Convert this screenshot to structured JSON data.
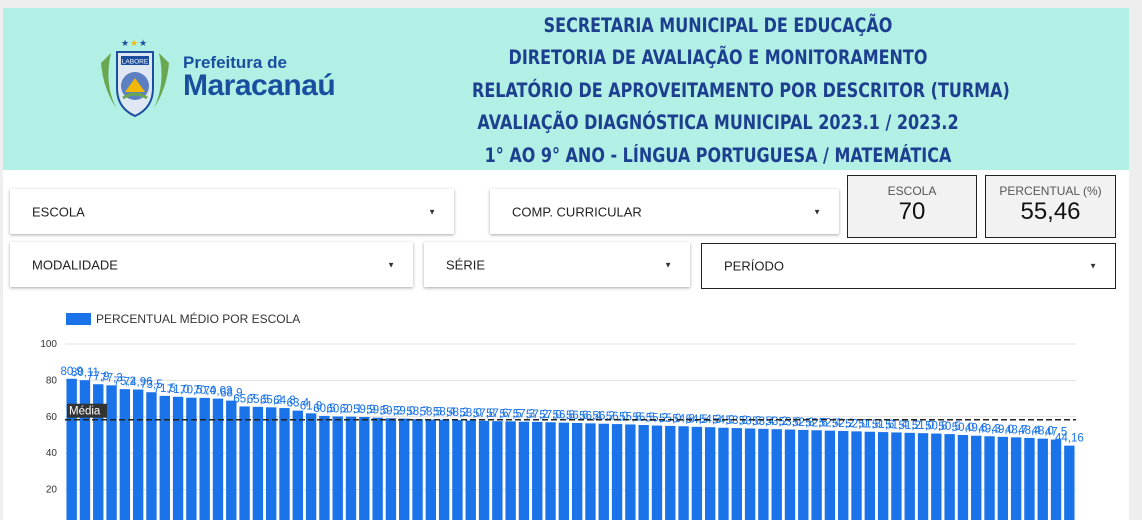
{
  "header": {
    "logo": {
      "line1": "Prefeitura de",
      "line2": "Maracanaú",
      "seal_text": "LABORE"
    },
    "title_lines": [
      "SECRETARIA MUNICIPAL DE EDUCAÇÃO",
      "DIRETORIA DE AVALIAÇÃO E MONITORAMENTO",
      "RELATÓRIO DE APROVEITAMENTO POR DESCRITOR (TURMA)",
      "AVALIAÇÃO DIAGNÓSTICA MUNICIPAL 2023.1 / 2023.2",
      "1° AO  9° ANO -  LÍNGUA PORTUGUESA / MATEMÁTICA"
    ]
  },
  "filters": {
    "escola": "ESCOLA",
    "comp_curricular": "COMP. CURRICULAR",
    "modalidade": "MODALIDADE",
    "serie": "SÉRIE",
    "periodo": "PERÍODO",
    "arrow_icon": "dropdown-arrow-icon"
  },
  "scorecards": {
    "escola": {
      "label": "ESCOLA",
      "value": "70"
    },
    "percentual": {
      "label": "PERCENTUAL (%)",
      "value": "55,46"
    }
  },
  "colors": {
    "header_bg": "#b2efe5",
    "title": "#1d3f8f",
    "bar": "#1a73e8",
    "logo": "#1a4fa0"
  },
  "chart_data": {
    "type": "bar",
    "legend": "PERCENTUAL MÉDIO POR ESCOLA",
    "reference_line": {
      "label": "Média",
      "value": 58.4
    },
    "ylim": [
      0,
      100
    ],
    "yticks": [
      0,
      20,
      40,
      60,
      80,
      100
    ],
    "grid": true,
    "values": [
      80.9,
      80.11,
      77.9,
      77.3,
      75.2,
      75.0,
      73.5,
      71.5,
      71.0,
      70.5,
      70.4,
      70.0,
      68.9,
      65.7,
      65.5,
      65.2,
      64.8,
      63.4,
      61.9,
      60.5,
      60.2,
      60.1,
      59.9,
      59.5,
      59.2,
      59.0,
      58.7,
      58.5,
      58.4,
      58.2,
      58.0,
      57.8,
      57.6,
      57.5,
      57.3,
      57.2,
      57.0,
      56.8,
      56.6,
      56.4,
      56.2,
      56.0,
      55.8,
      55.5,
      55.2,
      55.0,
      54.8,
      54.5,
      54.3,
      54.0,
      53.8,
      53.6,
      53.4,
      53.2,
      53.0,
      52.8,
      52.6,
      52.4,
      52.2,
      52.0,
      51.8,
      51.6,
      51.4,
      51.2,
      51.0,
      50.8,
      50.5,
      50.0,
      49.6,
      49.3,
      49.0,
      48.7,
      48.4,
      48.0,
      47.5,
      44.16
    ],
    "value_labels": [
      "80,9",
      "80,11",
      "77,9",
      "77,3",
      "75,2",
      "74,96",
      "73,5",
      "71,5",
      "71,0",
      "70,5",
      "70,4",
      "70,03",
      "68,9",
      "65,7",
      "65,5",
      "65,2",
      "64,8",
      "63,4",
      "61,9",
      "60,5",
      "60,2",
      "60,1",
      "59,9",
      "59,5",
      "59,2",
      "59,0",
      "58,7",
      "58,5",
      "58,4",
      "58,2",
      "58,0",
      "57,8",
      "57,6",
      "57,5",
      "57,3",
      "57,2",
      "57,0",
      "56,8",
      "56,6",
      "56,4",
      "56,2",
      "56,0",
      "55,8",
      "55,5",
      "55,2",
      "55,0",
      "54,8",
      "54,5",
      "54,3",
      "54,0",
      "53,8",
      "53,6",
      "53,4",
      "53,2",
      "53,0",
      "52,8",
      "52,6",
      "52,4",
      "52,2",
      "52,0",
      "51,8",
      "51,6",
      "51,4",
      "51,2",
      "51,0",
      "50,8",
      "50,5",
      "50,0",
      "49,6",
      "49,3",
      "49,0",
      "48,7",
      "48,4",
      "48,0",
      "47,5",
      "44,16"
    ]
  }
}
